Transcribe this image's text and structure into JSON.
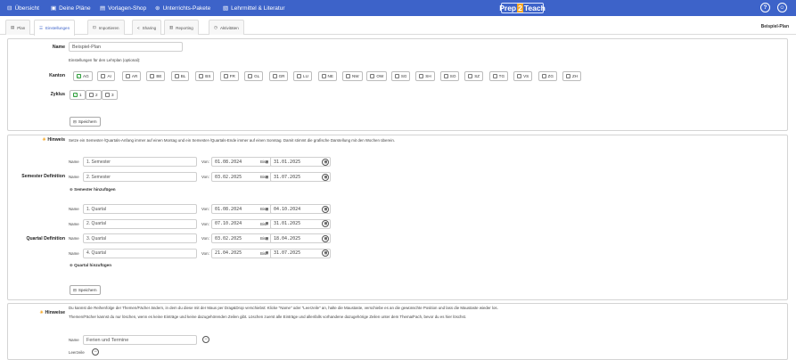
{
  "topnav": {
    "items": [
      {
        "icon": "⊟",
        "label": "Übersicht"
      },
      {
        "icon": "▣",
        "label": "Deine Pläne"
      },
      {
        "icon": "▤",
        "label": "Vorlagen-Shop"
      },
      {
        "icon": "⊛",
        "label": "Unterrichts-Pakete"
      },
      {
        "icon": "▧",
        "label": "Lehrmittel & Literatur"
      }
    ],
    "brand_left": "Prep",
    "brand_mid": "2",
    "brand_right": "Teach",
    "help_icon": "?",
    "user_icon": "☺"
  },
  "tabs": [
    {
      "icon": "▤",
      "label": "Plan"
    },
    {
      "icon": "☰",
      "label": "Einstellungen"
    },
    {
      "icon": "⊡",
      "label": "Importieren"
    },
    {
      "icon": "<",
      "label": "Sharing"
    },
    {
      "icon": "▥",
      "label": "Reporting"
    },
    {
      "icon": "◷",
      "label": "Aktivitäten"
    }
  ],
  "context_title": "Beispiel-Plan",
  "settings": {
    "name_label": "Name",
    "name_value": "Beispiel-Plan",
    "name_hint": "Einstellungen für den Lehrplan (optional):",
    "kanton_label": "Kanton",
    "kantons": [
      {
        "code": "AG",
        "checked": true
      },
      {
        "code": "AI",
        "checked": false
      },
      {
        "code": "AR",
        "checked": false
      },
      {
        "code": "BE",
        "checked": false
      },
      {
        "code": "BL",
        "checked": false
      },
      {
        "code": "BS",
        "checked": false
      },
      {
        "code": "FR",
        "checked": false
      },
      {
        "code": "GL",
        "checked": false
      },
      {
        "code": "GR",
        "checked": false
      },
      {
        "code": "LU",
        "checked": false
      },
      {
        "code": "NE",
        "checked": false
      },
      {
        "code": "NW",
        "checked": false
      },
      {
        "code": "OW",
        "checked": false
      },
      {
        "code": "SG",
        "checked": false
      },
      {
        "code": "SH",
        "checked": false
      },
      {
        "code": "SO",
        "checked": false
      },
      {
        "code": "SZ",
        "checked": false
      },
      {
        "code": "TG",
        "checked": false
      },
      {
        "code": "VS",
        "checked": false
      },
      {
        "code": "ZG",
        "checked": false
      },
      {
        "code": "ZH",
        "checked": false
      }
    ],
    "zyklus_label": "Zyklus",
    "zyklus": [
      {
        "code": "1",
        "checked": true
      },
      {
        "code": "2",
        "checked": false
      },
      {
        "code": "3",
        "checked": false
      }
    ],
    "save_label": "Speichern"
  },
  "periods": {
    "hint_label": "Hinweis",
    "hint_text": "Setze ein Semester-/Quartals-Anfang immer auf einen Montag und ein Semester-/Quartals-Ende immer auf einen Sonntag. Damit stimmt die grafische Darstellung mit den Wochen überein.",
    "name_prefix": "Name",
    "von_label": "Von:",
    "bis_label": "Bis:",
    "semester_label": "Semester Definition",
    "semesters": [
      {
        "name": "1. Semester",
        "von": "01.08.2024",
        "bis": "31.01.2025"
      },
      {
        "name": "2. Semester",
        "von": "03.02.2025",
        "bis": "31.07.2025"
      }
    ],
    "add_semester": "Semester hinzufügen",
    "quartal_label": "Quartal Definition",
    "quartals": [
      {
        "name": "1. Quartal",
        "von": "01.08.2024",
        "bis": "04.10.2024"
      },
      {
        "name": "2. Quartal",
        "von": "07.10.2024",
        "bis": "31.01.2025"
      },
      {
        "name": "3. Quartal",
        "von": "03.02.2025",
        "bis": "18.04.2025"
      },
      {
        "name": "4. Quartal",
        "von": "21.04.2025",
        "bis": "31.07.2025"
      }
    ],
    "add_quartal": "Quartal hinzufügen",
    "save_label": "Speichern"
  },
  "hints": {
    "label": "Hinweise",
    "line1": "Du kannst die Reihenfolge der Themen/Fächer ändern, in dem du diese mit der Maus per Drag&Drop verschiebst: Klicke \"Name\" oder \"Leerzeile\" an, halte die Maustaste, verschiebe es an die gewünschte Position und lass die Maustaste wieder los.",
    "line2": "Themen/Fächer kannst du nur löschen, wenn es keine Einträge und keine dazugehörenden Zeilen gibt. Löschen zuerst alle Einträge und allenfalls vorhandene dazugehörige Zeilen unter dem Thema/Fach, bevor du es hier löschst.",
    "name_prefix": "Name",
    "topic_value": "Ferien und Termine",
    "leerzeile_label": "Leerzeile"
  }
}
